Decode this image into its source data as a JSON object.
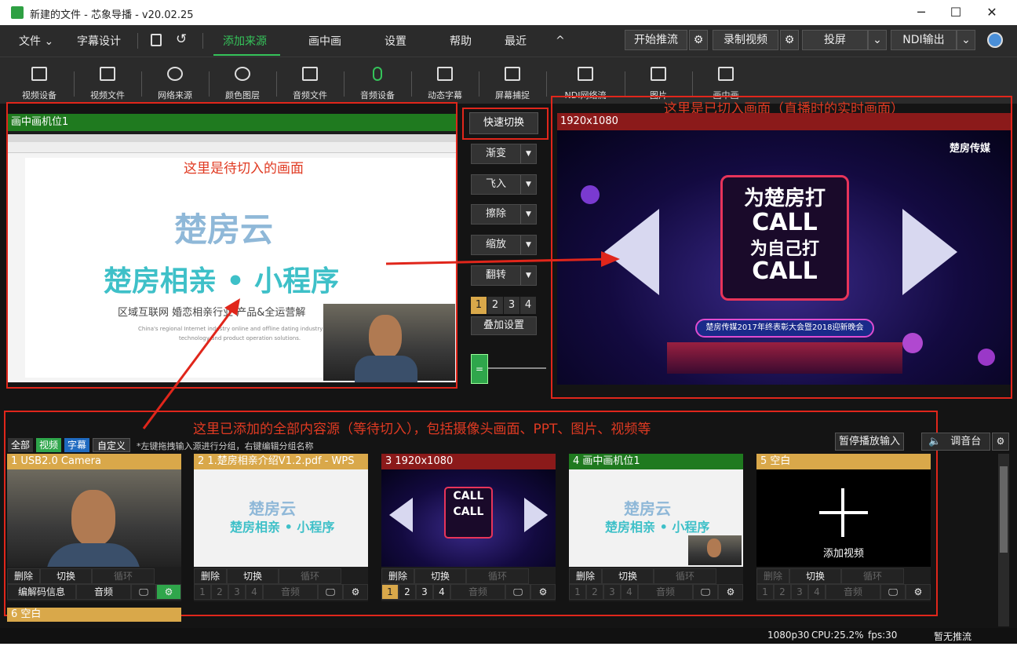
{
  "window": {
    "title": "新建的文件 - 芯象导播 - v20.02.25",
    "min": "─",
    "max": "☐",
    "close": "✕"
  },
  "menu": {
    "file": "文件",
    "subtitle_design": "字幕设计",
    "add_source": "添加来源",
    "pip": "画中画",
    "settings": "设置",
    "help": "帮助",
    "recent": "最近",
    "collapse": "^"
  },
  "topbuttons": {
    "start_stream": "开始推流",
    "record": "录制视频",
    "cast": "投屏",
    "ndi_out": "NDI输出"
  },
  "toolbar": [
    "视频设备",
    "视频文件",
    "网络来源",
    "颜色图层",
    "音频文件",
    "音频设备",
    "动态字幕",
    "屏幕捕捉",
    "NDI网络流",
    "图片",
    "画中画"
  ],
  "preview": {
    "title": "画中画机位1",
    "slide_line1": "楚房云",
    "slide_line2": "楚房相亲 • 小程序",
    "slide_line3": "区域互联网  婚恋相亲行业  产品&全运营解",
    "slide_line4": "China's regional Internet industry online and offline dating industry pro",
    "slide_line5": "technology and product operation solutions."
  },
  "transitions": {
    "quick": "快速切换",
    "fade": "渐变",
    "fly": "飞入",
    "wipe": "擦除",
    "zoom": "缩放",
    "flip": "翻转",
    "nums": [
      "1",
      "2",
      "3",
      "4"
    ],
    "overlay": "叠加设置"
  },
  "program": {
    "title": "1920x1080",
    "brand": "楚房传媒",
    "call1": "为楚房打",
    "call2": "CALL",
    "call3": "为自己打",
    "call4": "CALL",
    "banner": "楚房传媒2017年终表彰大会暨2018迎新晚会"
  },
  "annotations": {
    "preview": "这里是待切入的画面",
    "program": "这里是已切入画面（直播时的实时画面）",
    "sources": "这里已添加的全部内容源（等待切入），包括摄像头画面、PPT、图片、视频等"
  },
  "tabs": {
    "all": "全部",
    "video": "视频",
    "subtitle": "字幕",
    "custom": "自定义",
    "hint": "*左键拖拽输入源进行分组，右键编辑分组名称"
  },
  "right_controls": {
    "pause_input": "暂停播放输入",
    "mixer": "调音台"
  },
  "cards": [
    {
      "title": "1 USB2.0 Camera",
      "row1": [
        "删除",
        "切换",
        "循环"
      ],
      "row2": [
        "编解码信息",
        "音频"
      ]
    },
    {
      "title": "2 1.楚房相亲介绍V1.2.pdf - WPS",
      "row1": [
        "删除",
        "切换",
        "循环"
      ],
      "row2": [
        "1",
        "2",
        "3",
        "4",
        "音频"
      ]
    },
    {
      "title": "3 1920x1080",
      "row1": [
        "删除",
        "切换",
        "循环"
      ],
      "row2": [
        "1",
        "2",
        "3",
        "4",
        "音频"
      ]
    },
    {
      "title": "4 画中画机位1",
      "row1": [
        "删除",
        "切换",
        "循环"
      ],
      "row2": [
        "1",
        "2",
        "3",
        "4",
        "音频"
      ]
    },
    {
      "title": "5 空白",
      "center": "添加视频",
      "row1": [
        "删除",
        "切换",
        "循环"
      ],
      "row2": [
        "1",
        "2",
        "3",
        "4",
        "音频"
      ]
    }
  ],
  "card6": "6 空白",
  "status": {
    "res": "1080p30",
    "cpu": "CPU:25.2%",
    "fps": "fps:30",
    "stream": "暂无推流"
  },
  "colors": {
    "accent": "#35c35a",
    "header_green": "#1f7a1f",
    "header_gold": "#d9a84a",
    "header_red": "#8b1a1a",
    "annotation": "#e0261b"
  }
}
